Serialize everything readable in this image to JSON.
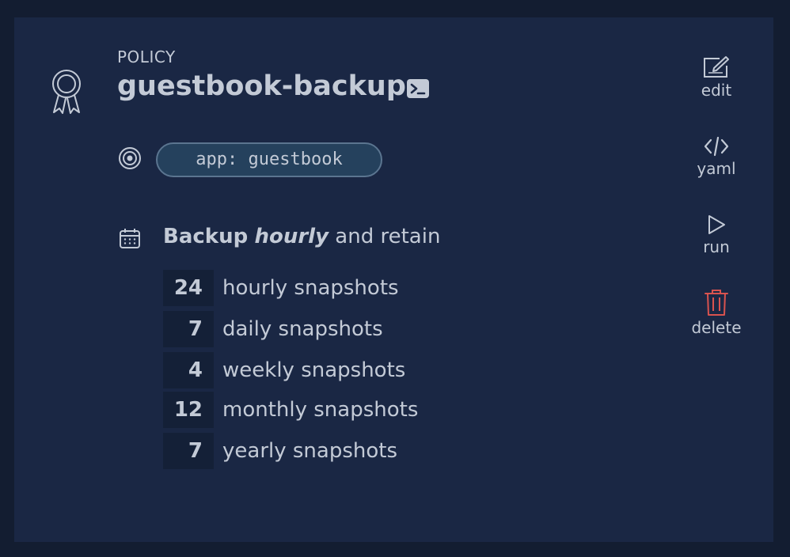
{
  "policy": {
    "label": "POLICY",
    "name": "guestbook-backup",
    "selector": "app: guestbook"
  },
  "schedule": {
    "prefix": "Backup",
    "frequency": "hourly",
    "suffix": "and retain"
  },
  "retention": [
    {
      "count": "24",
      "label": "hourly snapshots"
    },
    {
      "count": "7",
      "label": "daily snapshots"
    },
    {
      "count": "4",
      "label": "weekly snapshots"
    },
    {
      "count": "12",
      "label": "monthly snapshots"
    },
    {
      "count": "7",
      "label": "yearly snapshots"
    }
  ],
  "actions": {
    "edit": "edit",
    "yaml": "yaml",
    "run": "run",
    "delete": "delete"
  },
  "colors": {
    "background": "#131d31",
    "card": "#1a2744",
    "text": "#c3cad6",
    "pill_border": "#5b7590",
    "pill_fill": "#25415d",
    "count_box": "#142037",
    "delete": "#d9534f"
  },
  "icons": {
    "policy": "award-ribbon-icon",
    "cli": "terminal-icon",
    "selector": "target-icon",
    "schedule": "calendar-icon",
    "edit": "edit-icon",
    "yaml": "code-icon",
    "run": "play-icon",
    "delete": "trash-icon"
  }
}
